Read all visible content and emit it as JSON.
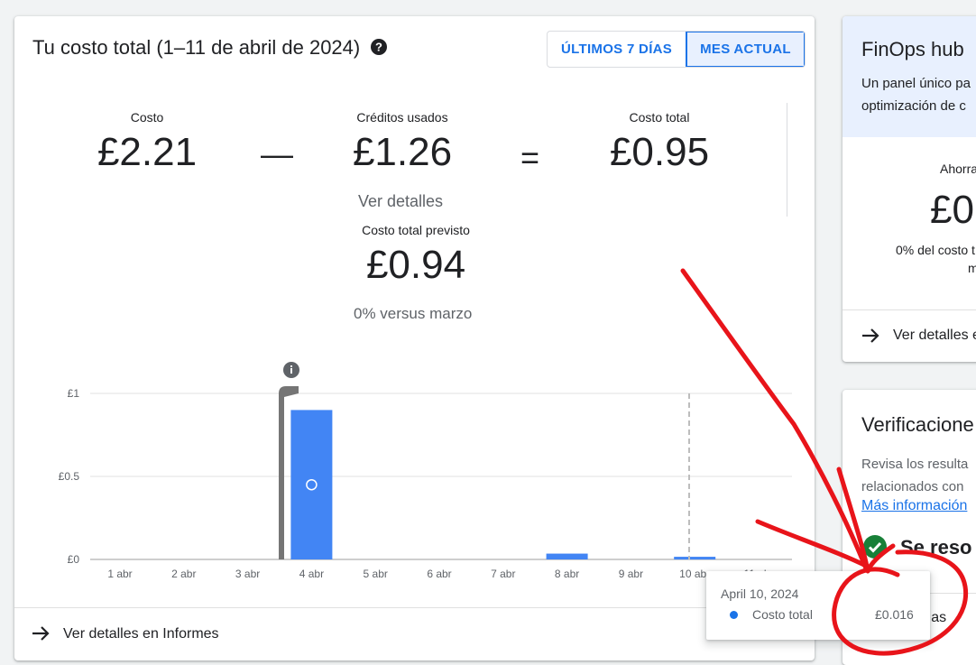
{
  "main": {
    "title": "Tu costo total (1–11 de abril de 2024)",
    "toggle": [
      "ÚLTIMOS 7 DÍAS",
      "MES ACTUAL"
    ],
    "metrics": {
      "cost_label": "Costo",
      "cost_value": "£2.21",
      "credits_label": "Créditos usados",
      "credits_value": "£1.26",
      "total_label": "Costo total",
      "total_value": "£0.95",
      "minus": "—",
      "equals": "=",
      "details_link": "Ver detalles",
      "forecast_label": "Costo total previsto",
      "forecast_value": "£0.94",
      "forecast_change": "0% versus marzo"
    },
    "footer_link": "Ver detalles en Informes"
  },
  "chart_data": {
    "type": "bar",
    "categories": [
      "1 abr",
      "2 abr",
      "3 abr",
      "4 abr",
      "5 abr",
      "6 abr",
      "7 abr",
      "8 abr",
      "9 abr",
      "10 abr",
      "11 abr"
    ],
    "series": [
      {
        "name": "Costo total",
        "values": [
          0,
          0,
          0,
          0.9,
          0,
          0,
          0,
          0.035,
          0,
          0.016,
          0
        ]
      }
    ],
    "yticks": [
      "£0",
      "£0.5",
      "£1"
    ],
    "ylim": [
      0,
      1
    ],
    "grid": true,
    "colors": {
      "bar": "#4285f4",
      "grid": "#e0e0e0"
    }
  },
  "tooltip": {
    "date": "April 10, 2024",
    "series": "Costo total",
    "value": "£0.016"
  },
  "side1": {
    "title": "FinOps hub",
    "desc1": "Un panel único pa",
    "desc2": "optimización de c",
    "label": "Ahorra",
    "value": "£0",
    "sub1": "0% del costo t",
    "sub2": "m",
    "link": "Ver detalles e"
  },
  "side2": {
    "title": "Verificacione",
    "desc1": "Revisa los resulta",
    "desc2": "relacionados con",
    "link": "Más información",
    "status": "Se reso",
    "footer_partial": "das as"
  }
}
